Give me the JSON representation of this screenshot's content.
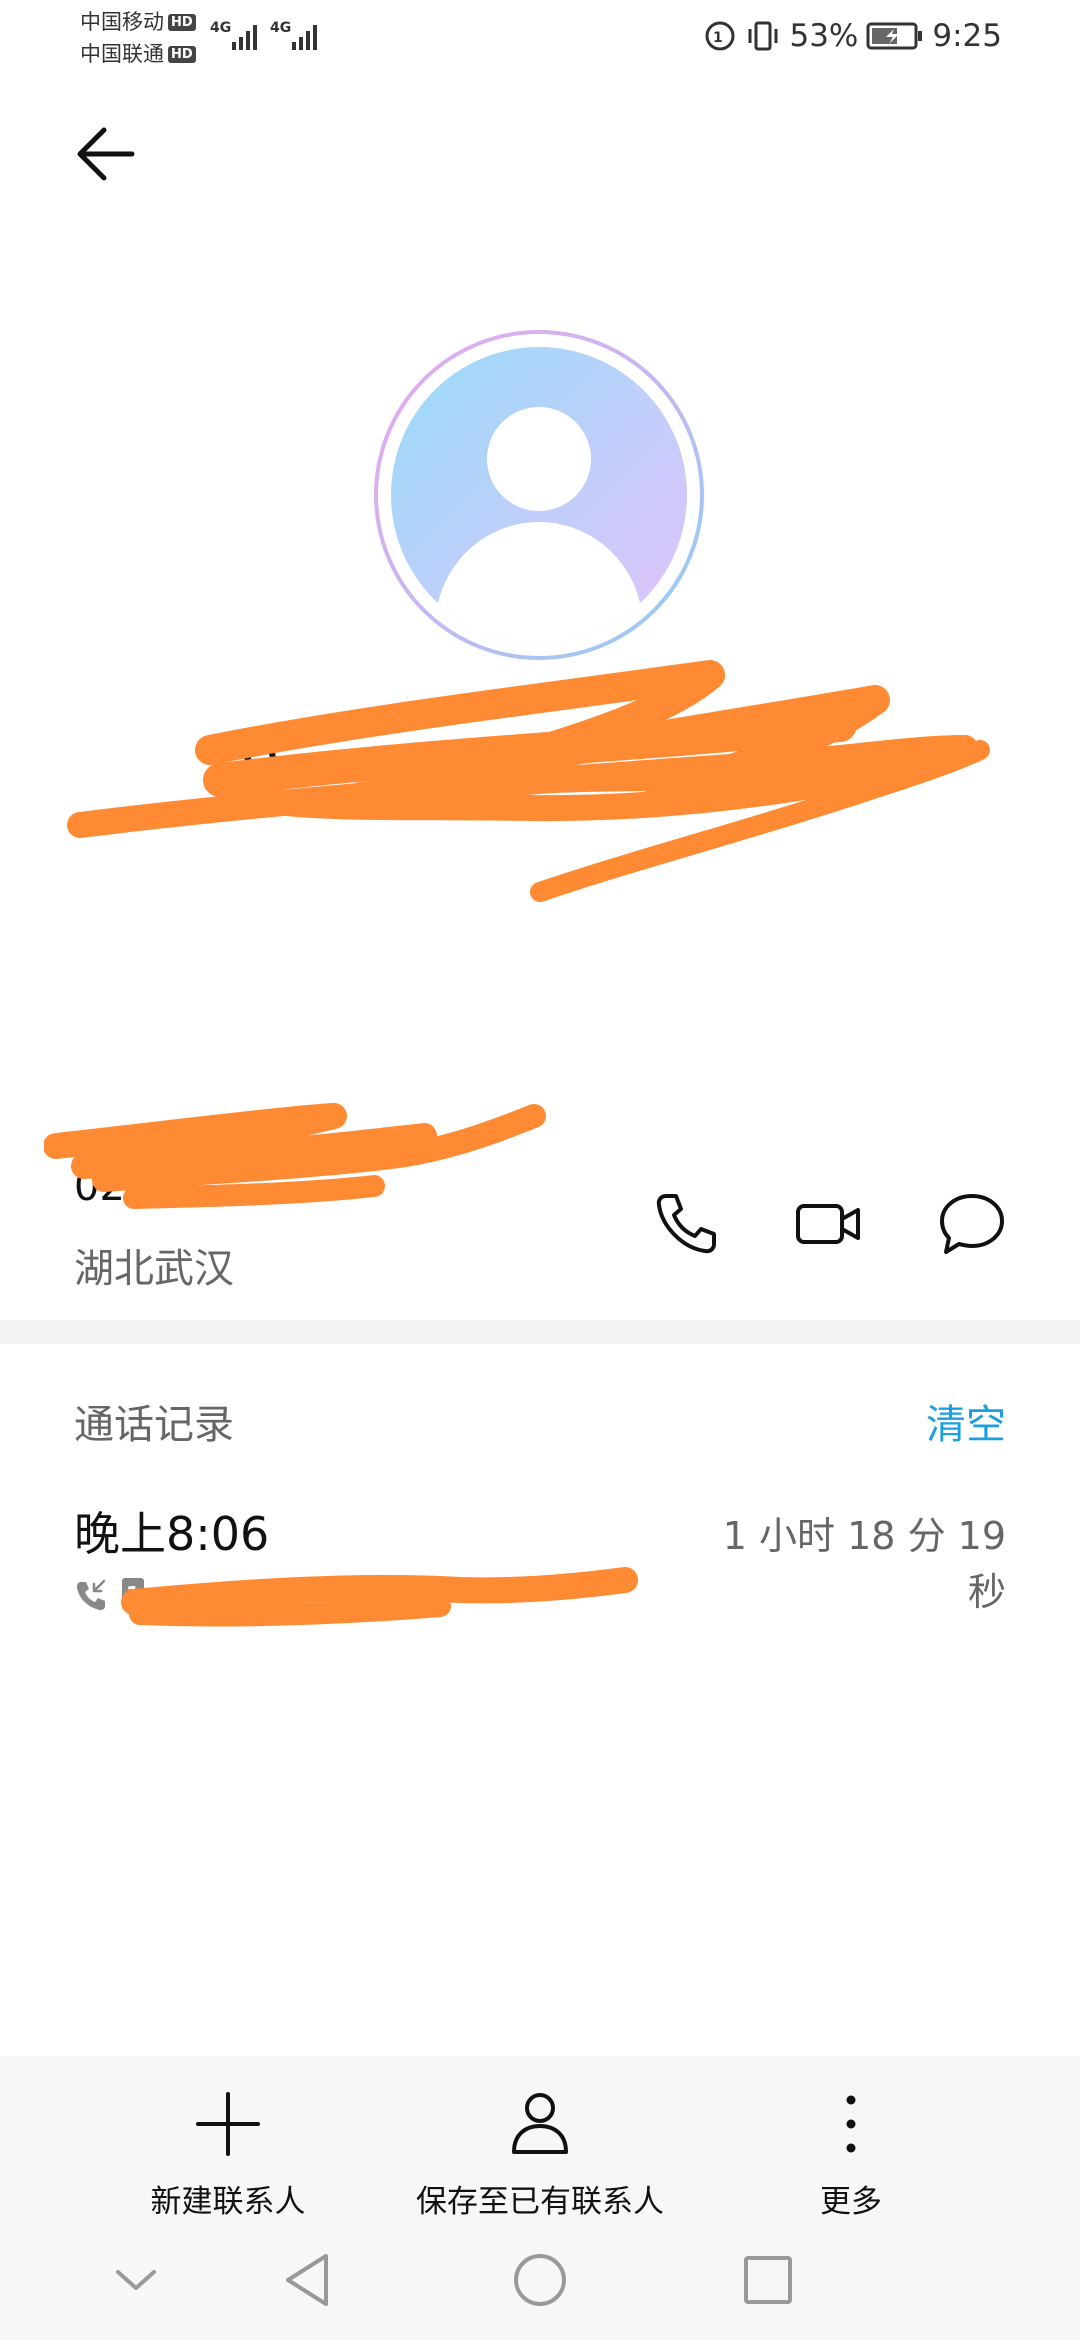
{
  "status_bar": {
    "carrier1": "中国移动",
    "carrier2": "中国联通",
    "hd": "HD",
    "net1": "4G",
    "net2": "4G",
    "battery": "53%",
    "time": "9:25"
  },
  "contact": {
    "name": "0",
    "number_fragment": "02",
    "location": "湖北武汉"
  },
  "call_history": {
    "title": "通话记录",
    "clear_label": "清空",
    "entries": [
      {
        "time": "晚上8:06",
        "duration": "1 小时 18 分 19 秒",
        "sim": "1"
      }
    ]
  },
  "toolbar": {
    "new_contact": "新建联系人",
    "save_existing": "保存至已有联系人",
    "more": "更多"
  },
  "colors": {
    "accent": "#1a9fe0",
    "scribble": "#ff8a34"
  }
}
